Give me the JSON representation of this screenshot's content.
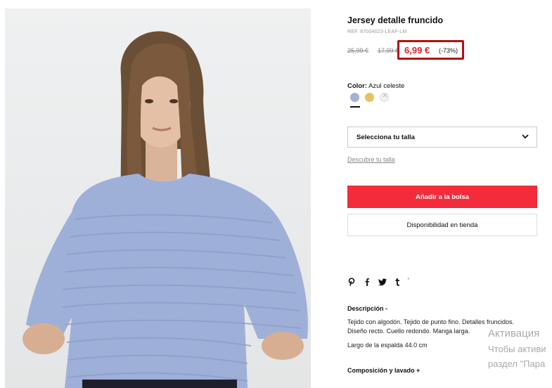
{
  "product": {
    "title": "Jersey detalle fruncido",
    "ref": "REF. 87004023-LEAF-LM",
    "old_price_1": "25,99 €",
    "old_price_2": "17,99 €",
    "price": "6,99 €",
    "discount": "(-73%)",
    "accent_color": "#e3232f",
    "highlight_box_color": "#b30f16"
  },
  "color": {
    "label": "Color:",
    "value": "Azul celeste",
    "swatches": [
      {
        "name": "blue",
        "hex": "#a5b2d3",
        "selected": true
      },
      {
        "name": "yellow",
        "hex": "#e4c25e",
        "selected": false
      },
      {
        "name": "unavailable",
        "hex": "#f2f2f2",
        "selected": false,
        "glyph": "✕"
      }
    ]
  },
  "size": {
    "select_label": "Selecciona tu talla",
    "guide_link": "Descubre tu talla"
  },
  "actions": {
    "add_to_bag": "Añadir a la bolsa",
    "add_to_bag_color": "#f32b3b",
    "store_availability": "Disponibilidad en tienda"
  },
  "social": {
    "icons": [
      "pinterest-icon",
      "facebook-icon",
      "twitter-icon",
      "tumblr-icon"
    ],
    "more": "'"
  },
  "description": {
    "heading": "Descripción -",
    "line1": "Tejido con algodón. Tejido de punto fino. Detalles fruncidos.",
    "line2": "Diseño recto. Cuello redondo. Manga larga.",
    "line3": "Largo de la espalda 44.0 cm"
  },
  "composition": {
    "heading": "Composición y lavado +"
  },
  "watermark": {
    "line1": "Активация",
    "line2": "Чтобы активи",
    "line3": "раздел \"Пара"
  }
}
